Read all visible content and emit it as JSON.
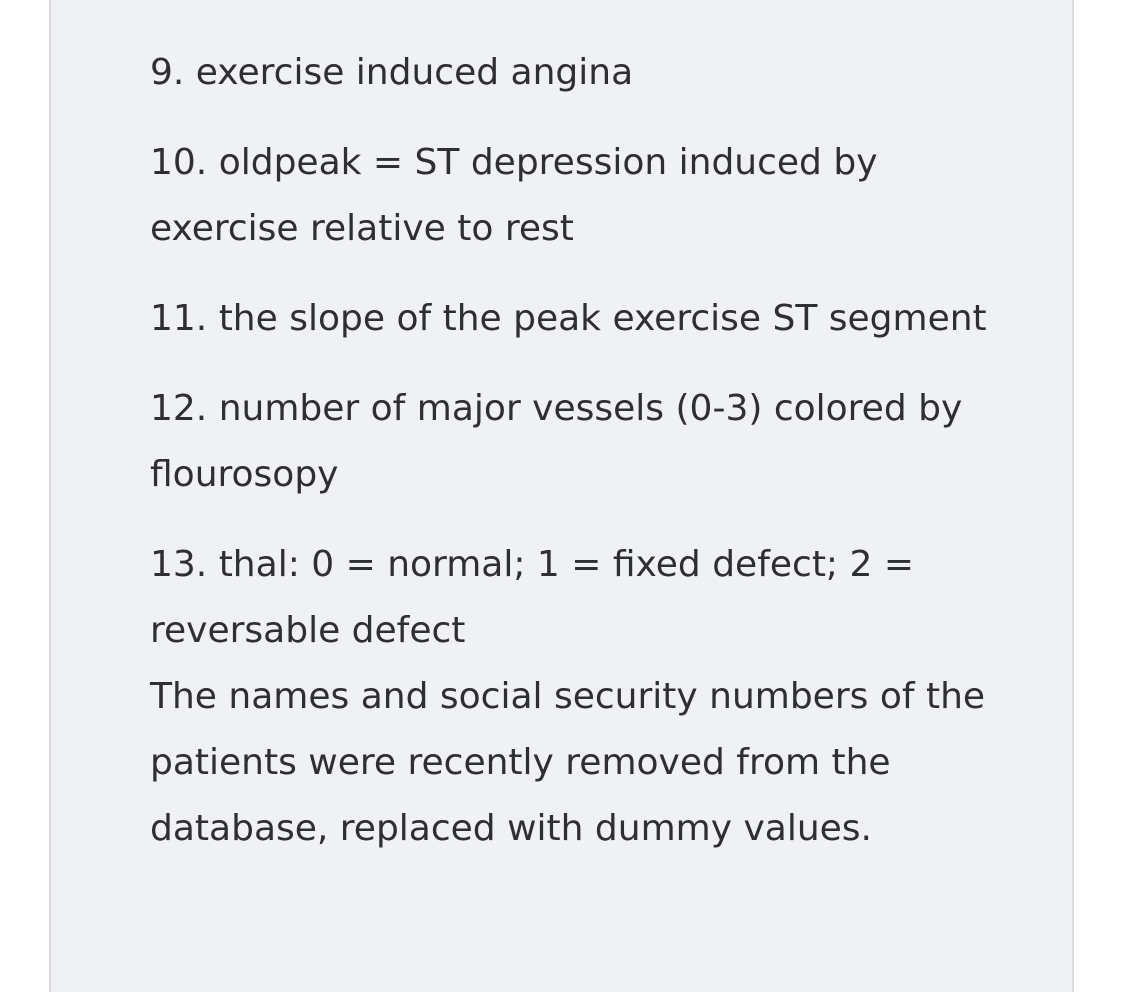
{
  "items": [
    "9. exercise induced angina",
    "10. oldpeak = ST depression induced by exercise relative to rest",
    "11. the slope of the peak exercise ST segment",
    "12. number of major vessels (0-3) colored by flourosopy",
    "13. thal: 0 = normal; 1 = fixed defect; 2 = reversable defect"
  ],
  "note": "The names and social security numbers of the patients were recently removed from the database, replaced with dummy values."
}
